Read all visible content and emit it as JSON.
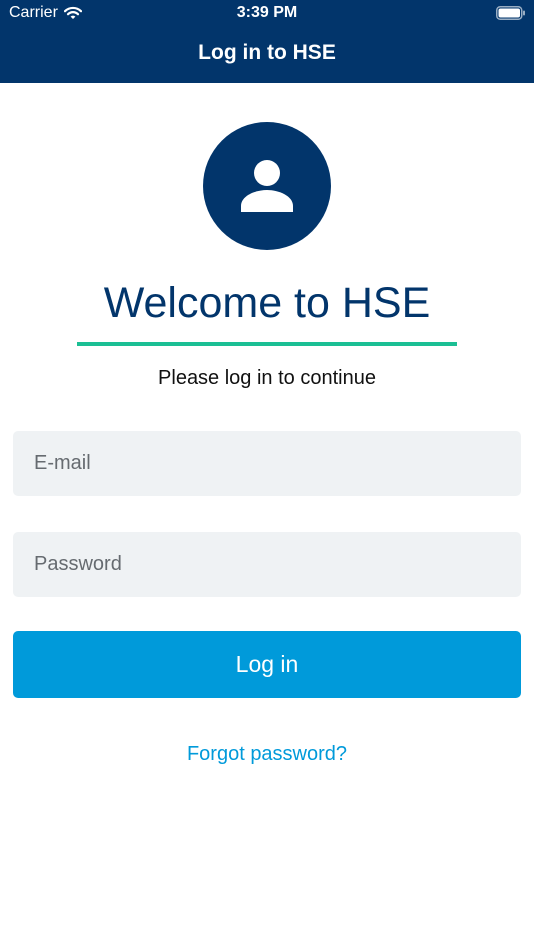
{
  "status_bar": {
    "carrier": "Carrier",
    "time": "3:39 PM",
    "wifi_icon": "wifi-icon",
    "battery_icon": "battery-icon"
  },
  "nav": {
    "title": "Log in to HSE"
  },
  "welcome": {
    "avatar_icon": "user-icon",
    "heading": "Welcome to HSE",
    "subtitle": "Please log in to continue"
  },
  "form": {
    "email_placeholder": "E-mail",
    "email_value": "",
    "password_placeholder": "Password",
    "password_value": "",
    "login_label": "Log in",
    "forgot_label": "Forgot password?"
  },
  "colors": {
    "header_bg": "#02356b",
    "accent_line": "#1bbf94",
    "primary_button": "#009ada",
    "field_bg": "#eff2f4"
  }
}
